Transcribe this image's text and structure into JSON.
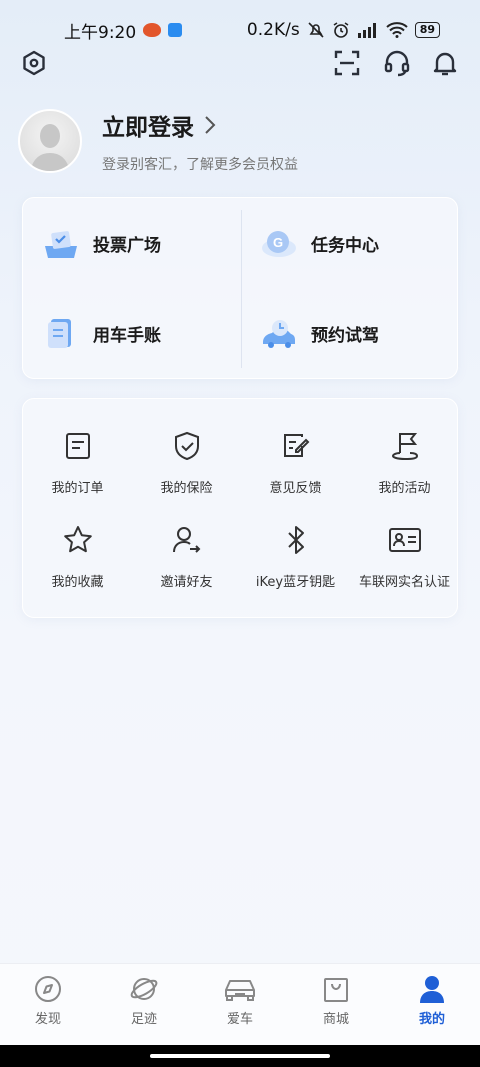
{
  "status": {
    "time": "上午9:20",
    "network_speed": "0.2K/s",
    "battery": "89"
  },
  "profile": {
    "title": "立即登录",
    "subtitle": "登录别客汇，了解更多会员权益"
  },
  "quick_actions": [
    {
      "label": "投票广场",
      "icon": "vote-icon"
    },
    {
      "label": "任务中心",
      "icon": "task-icon"
    },
    {
      "label": "用车手账",
      "icon": "notebook-icon"
    },
    {
      "label": "预约试驾",
      "icon": "test-drive-icon"
    }
  ],
  "services": [
    {
      "label": "我的订单",
      "icon": "order-icon"
    },
    {
      "label": "我的保险",
      "icon": "shield-icon"
    },
    {
      "label": "意见反馈",
      "icon": "feedback-icon"
    },
    {
      "label": "我的活动",
      "icon": "flag-icon"
    },
    {
      "label": "我的收藏",
      "icon": "star-icon"
    },
    {
      "label": "邀请好友",
      "icon": "invite-icon"
    },
    {
      "label": "iKey蓝牙钥匙",
      "icon": "bluetooth-icon"
    },
    {
      "label": "车联网实名认证",
      "icon": "id-card-icon"
    }
  ],
  "tabs": [
    {
      "label": "发现",
      "icon": "compass-icon"
    },
    {
      "label": "足迹",
      "icon": "planet-icon"
    },
    {
      "label": "爱车",
      "icon": "car-icon"
    },
    {
      "label": "商城",
      "icon": "shopping-bag-icon"
    },
    {
      "label": "我的",
      "icon": "user-icon",
      "active": true
    }
  ],
  "colors": {
    "accent": "#1f5fd6",
    "quick_icon_blue": "#5b9bf0"
  }
}
